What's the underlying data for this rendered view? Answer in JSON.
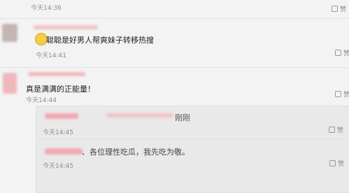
{
  "comments": [
    {
      "time": "今天14:36",
      "like": "赞"
    },
    {
      "text": "聪聪是好男人帮爽妹子转移热搜",
      "time": "今天14:41",
      "like": "赞"
    },
    {
      "text": "真是满满的正能量！",
      "time": "今天14:44",
      "like": "赞"
    }
  ],
  "replies": [
    {
      "text": "刚刚",
      "time": "今天14:45",
      "like": "赞"
    },
    {
      "text": "、各位理性吃瓜，我先吃为敬。",
      "time": "今天14:45",
      "like": "赞"
    }
  ],
  "colors": {
    "name_blur": "#f1a7b0",
    "avatar_blur": "#c7b6b6"
  }
}
